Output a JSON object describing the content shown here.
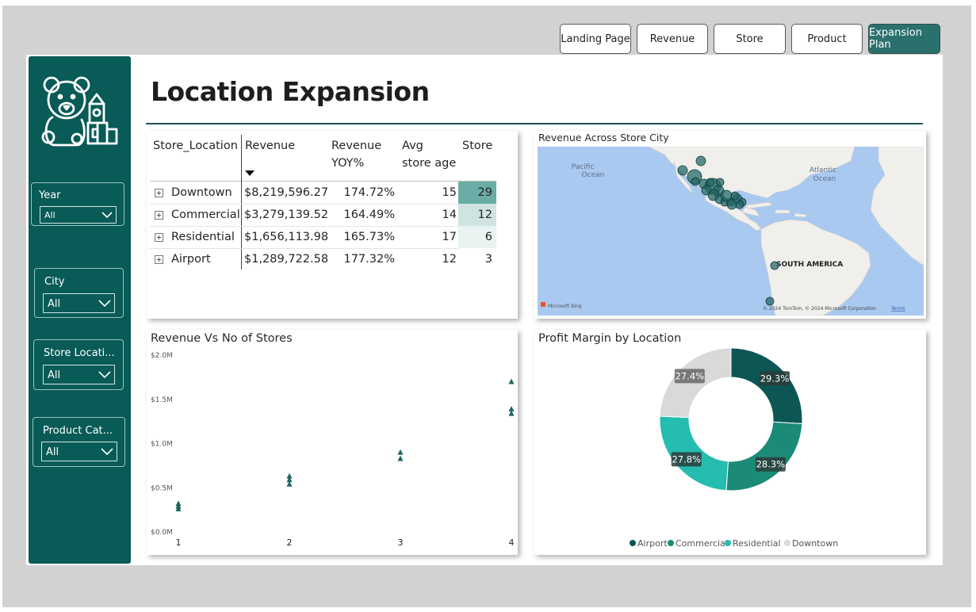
{
  "nav": {
    "buttons": [
      {
        "label": "Landing Page",
        "active": false
      },
      {
        "label": "Revenue",
        "active": false
      },
      {
        "label": "Store",
        "active": false
      },
      {
        "label": "Product",
        "active": false
      },
      {
        "label": "Expansion Plan",
        "active": true
      }
    ]
  },
  "sidebar": {
    "logo_icon": "teddy-bear-toy-blocks-icon",
    "slicers": [
      {
        "label": "Year",
        "value": "All"
      },
      {
        "label": "City",
        "value": "All"
      },
      {
        "label": "Store Locati...",
        "value": "All"
      },
      {
        "label": "Product Cat...",
        "value": "All"
      }
    ]
  },
  "page": {
    "title": "Location Expansion"
  },
  "matrix": {
    "headers": {
      "location": "Store_Location",
      "revenue": "Revenue",
      "yoy_1": "Revenue",
      "yoy_2": "YOY%",
      "age_1": "Avg",
      "age_2": "store age",
      "store": "Store"
    },
    "rows": [
      {
        "location": "Downtown",
        "revenue": "$8,219,596.27",
        "yoy": "174.72%",
        "age": "15",
        "store": "29",
        "store_bg": "#6aaca6"
      },
      {
        "location": "Commercial",
        "revenue": "$3,279,139.52",
        "yoy": "164.49%",
        "age": "14",
        "store": "12",
        "store_bg": "#cfe4e1"
      },
      {
        "location": "Residential",
        "revenue": "$1,656,113.98",
        "yoy": "165.73%",
        "age": "17",
        "store": "6",
        "store_bg": "#e9f3f2"
      },
      {
        "location": "Airport",
        "revenue": "$1,289,722.58",
        "yoy": "177.32%",
        "age": "12",
        "store": "3",
        "store_bg": "#ffffff"
      }
    ]
  },
  "map": {
    "title": "Revenue Across Store City",
    "labels": {
      "pacific_1": "Pacific",
      "pacific_2": "Ocean",
      "atlantic_1": "Atlantic",
      "atlantic_2": "Ocean",
      "south_america": "SOUTH AMERICA"
    },
    "attribution": "© 2024 TomTom, © 2024 Microsoft Corporation",
    "terms": "Terms",
    "bing": "Microsoft Bing",
    "colors": {
      "water": "#aac9f0",
      "land": "#f0efec",
      "bubble": "#1f6462"
    }
  },
  "chart_data": [
    {
      "type": "scatter",
      "title": "Revenue Vs No of Stores",
      "xlabel": "",
      "ylabel": "",
      "x_ticks": [
        "1",
        "2",
        "3",
        "4"
      ],
      "y_ticks": [
        "$0.0M",
        "$0.5M",
        "$1.0M",
        "$1.5M",
        "$2.0M"
      ],
      "ylim": [
        0,
        2000000
      ],
      "xlim": [
        1,
        4
      ],
      "points": [
        {
          "x": 1,
          "y": 260000
        },
        {
          "x": 1,
          "y": 290000
        },
        {
          "x": 1,
          "y": 320000
        },
        {
          "x": 2,
          "y": 540000
        },
        {
          "x": 2,
          "y": 590000
        },
        {
          "x": 2,
          "y": 630000
        },
        {
          "x": 3,
          "y": 830000
        },
        {
          "x": 3,
          "y": 900000
        },
        {
          "x": 4,
          "y": 1340000
        },
        {
          "x": 4,
          "y": 1390000
        },
        {
          "x": 4,
          "y": 1700000
        }
      ],
      "color": "#1f6462"
    },
    {
      "type": "pie",
      "donut": true,
      "title": "Profit Margin by Location",
      "categories": [
        "Airport",
        "Commercial",
        "Residential",
        "Downtown"
      ],
      "values": [
        29.3,
        28.3,
        27.8,
        27.4
      ],
      "labels": [
        "29.3%",
        "28.3%",
        "27.8%",
        "27.4%"
      ],
      "colors": [
        "#0c5754",
        "#1b8b78",
        "#24bdb0",
        "#d9d9d9"
      ],
      "legend": "bottom"
    }
  ]
}
